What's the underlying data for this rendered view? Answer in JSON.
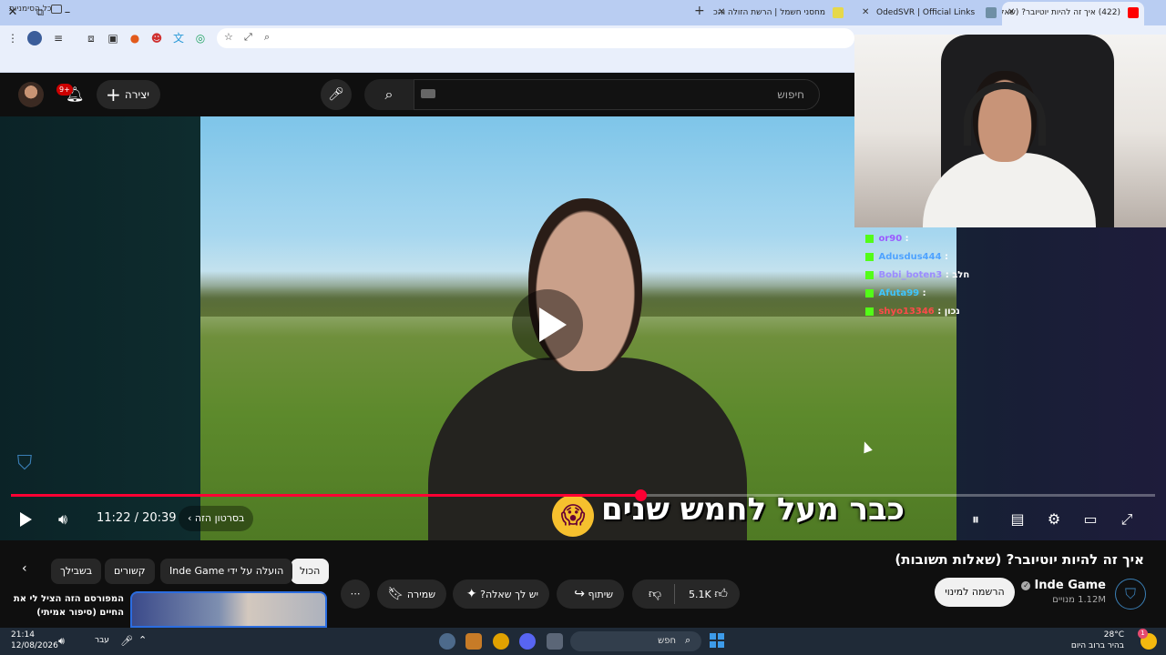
{
  "browser": {
    "tabs": [
      {
        "title": "(422) איך זה להיות יוטיובר? (שאל",
        "active": true,
        "favicon_color": "#ff0000"
      },
      {
        "title": "",
        "active": false,
        "favicon_color": "#6f8fa5"
      },
      {
        "title": "OdedSVR | Official Links",
        "active": false,
        "favicon_color": "#ffffff"
      },
      {
        "title": "מחסני חשמל | הרשת הזולה והכ",
        "active": false,
        "favicon_color": "#e6d84a"
      }
    ],
    "window_controls": {
      "close": "✕",
      "maximize": "⧉",
      "minimize": "–"
    },
    "bookmarks": {
      "all_label": "כל הסימניות"
    }
  },
  "youtube": {
    "search_placeholder": "חיפוש",
    "create_label": "יצירה",
    "notifications_badge": "9+",
    "player": {
      "current_time": "11:22",
      "duration": "20:39",
      "time_display": "11:22 / 20:39",
      "progress": 0.55,
      "chapter_label": "בסרטון הזה",
      "subtitle": "כבר מעל לחמש שנים"
    },
    "overlay_chat": [
      {
        "user": "or90",
        "message": "",
        "color": "#9b59ff"
      },
      {
        "user": "Adusdus444",
        "message": "",
        "color": "#4fa3ff"
      },
      {
        "user": "Bobi_boten3",
        "message": "חלב",
        "color": "#9b8cff"
      },
      {
        "user": "Afuta99",
        "message": "",
        "color": "#3fc6ff"
      },
      {
        "user": "shyo13346",
        "message": "נכון",
        "color": "#ff4a4a"
      }
    ],
    "video": {
      "title": "איך זה להיות יוטיובר? (שאלות תשובות)",
      "channel": "Inde Game",
      "subscribers": "1.12M מנויים",
      "subscribe_label": "הרשמה למינוי",
      "likes": "5.1K",
      "share_label": "שיתוף",
      "ask_label": "יש לך שאלה?",
      "save_label": "שמירה"
    },
    "chips": [
      "הכול",
      "הועלה על ידי Inde Game",
      "קשורים",
      "בשבילך"
    ],
    "related": {
      "title": "המפורסם הזה הציל לי את החיים (סיפור אמיתי)"
    }
  },
  "taskbar": {
    "time": "21:14",
    "date": "12/08/2026",
    "language": "עבר",
    "search_placeholder": "חפש",
    "weather_temp": "28°C",
    "weather_text": "בהיר ברוב היום",
    "notification_count": "1"
  },
  "colors": {
    "accent": "#ff0033",
    "kick_green": "#53fc18",
    "taskbar": "#1f2a37"
  }
}
